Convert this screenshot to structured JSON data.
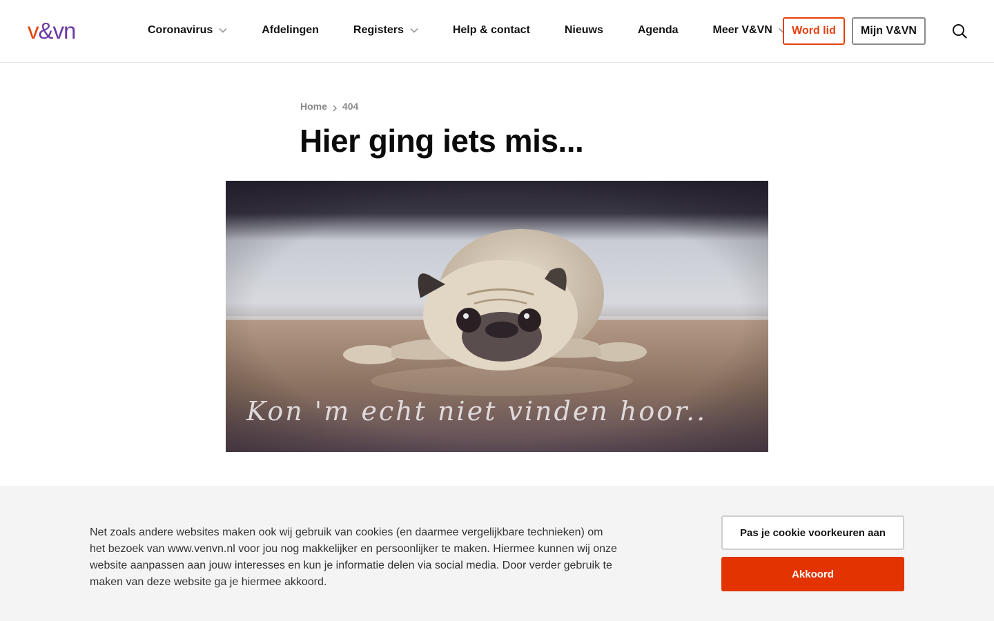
{
  "header": {
    "logo": {
      "part1": "v",
      "part2": "&",
      "part3": "vn",
      "alt": "V&VN"
    },
    "nav": [
      {
        "label": "Coronavirus",
        "has_dropdown": true
      },
      {
        "label": "Afdelingen",
        "has_dropdown": false
      },
      {
        "label": "Registers",
        "has_dropdown": true
      },
      {
        "label": "Help & contact",
        "has_dropdown": false
      },
      {
        "label": "Nieuws",
        "has_dropdown": false
      },
      {
        "label": "Agenda",
        "has_dropdown": false
      },
      {
        "label": "Meer V&VN",
        "has_dropdown": true
      }
    ],
    "word_lid_label": "Word lid",
    "mijn_label": "Mijn V&VN",
    "search_icon": "search-icon"
  },
  "breadcrumb": {
    "home": "Home",
    "current": "404"
  },
  "page": {
    "title": "Hier ging iets mis..."
  },
  "hero": {
    "caption": "Kon 'm echt niet vinden hoor.."
  },
  "cookie": {
    "text": "Net zoals andere websites maken ook wij gebruik van cookies (en daarmee vergelijkbare technieken) om het bezoek van www.venvn.nl voor jou nog makkelijker en persoonlijker te maken. Hiermee kunnen wij onze website aanpassen aan jouw interesses en kun je informatie delen via social media. Door verder gebruik te maken van deze website ga je hiermee akkoord.",
    "prefs_label": "Pas je cookie voorkeuren aan",
    "accept_label": "Akkoord"
  },
  "colors": {
    "brand_orange": "#e3400b",
    "brand_purple": "#6a3aa7",
    "accept_bg": "#e33300",
    "cookie_bg": "#f4f4f4"
  }
}
